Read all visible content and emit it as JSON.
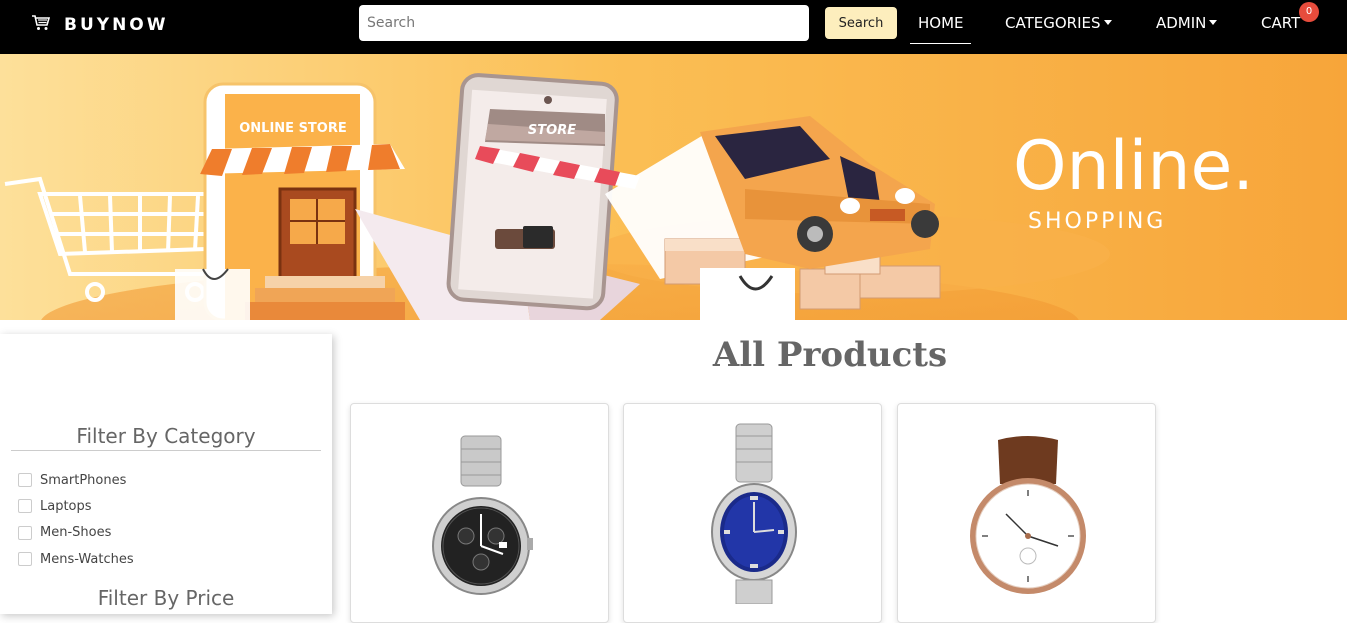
{
  "navbar": {
    "brand": "BUYNOW",
    "search_placeholder": "Search",
    "search_button": "Search",
    "links": {
      "home": "HOME",
      "categories": "CATEGORIES",
      "admin": "ADMIN",
      "cart": "CART"
    },
    "cart_count": "0"
  },
  "hero": {
    "headline": "Online.",
    "subheadline": "SHOPPING",
    "store_sign": "ONLINE STORE",
    "phone_sign": "STORE"
  },
  "sidebar": {
    "category_title": "Filter By Category",
    "categories": [
      "SmartPhones",
      "Laptops",
      "Men-Shoes",
      "Mens-Watches"
    ],
    "price_title": "Filter By Price"
  },
  "main": {
    "title": "All Products",
    "products": [
      {
        "image": "black-chronograph-watch"
      },
      {
        "image": "blue-dial-steel-watch"
      },
      {
        "image": "white-dial-leather-watch"
      }
    ]
  },
  "colors": {
    "navbar": "#000000",
    "search_button": "#fdeebd",
    "badge": "#e74c3c",
    "hero_orange": "#f7a83a"
  }
}
